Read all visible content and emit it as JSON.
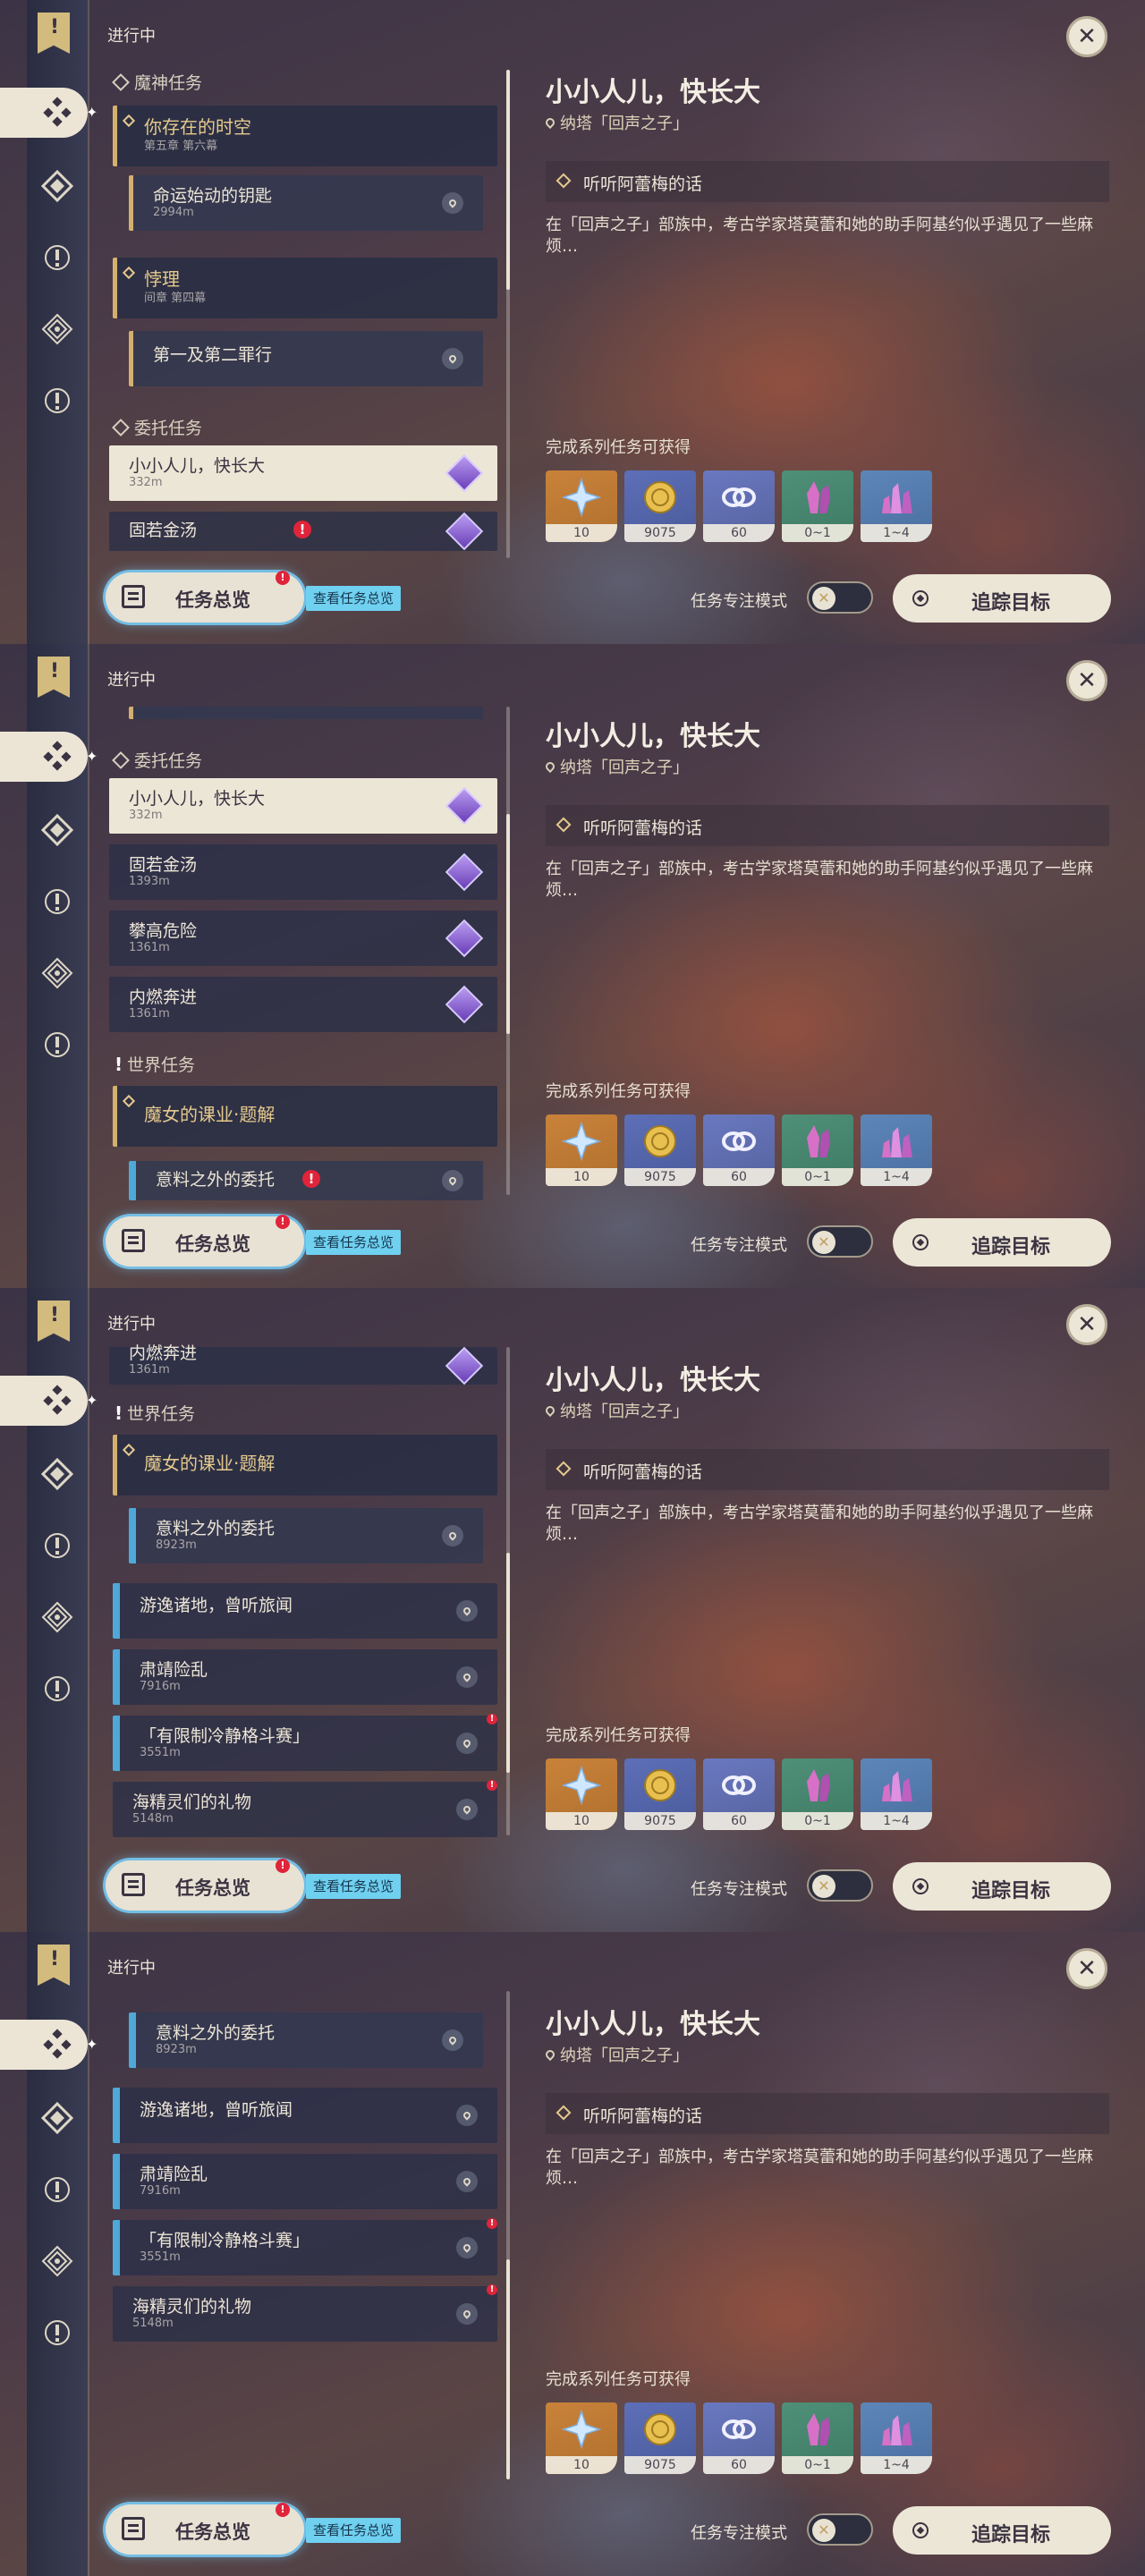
{
  "header": {
    "label": "进行中"
  },
  "sections": {
    "archon": "魔神任务",
    "commission": "委托任务",
    "world": "世界任务"
  },
  "archon_quests": [
    {
      "title": "你存在的时空",
      "chapter": "第五章 第六幕",
      "subquest": {
        "title": "命运始动的钥匙",
        "distance": "2994m"
      }
    },
    {
      "title": "悖理",
      "chapter": "间章 第四幕",
      "subquest": {
        "title": "第一及第二罪行",
        "distance": ""
      }
    }
  ],
  "commissions": [
    {
      "title": "小小人儿，快长大",
      "distance": "332m"
    },
    {
      "title": "固若金汤",
      "distance": "1393m"
    },
    {
      "title": "攀高危险",
      "distance": "1361m"
    },
    {
      "title": "内燃奔进",
      "distance": "1361m"
    }
  ],
  "world_group": {
    "title": "魔女的课业·题解"
  },
  "world_quests": [
    {
      "title": "意料之外的委托",
      "distance": "8923m"
    },
    {
      "title": "游逸诸地，曾听旅闻",
      "distance": ""
    },
    {
      "title": "肃靖险乱",
      "distance": "7916m"
    },
    {
      "title": "「有限制冷静格斗赛」",
      "distance": "3551m"
    },
    {
      "title": "海精灵们的礼物",
      "distance": "5148m"
    }
  ],
  "buttons": {
    "overview": "任务总览",
    "view_overview": "查看任务总览",
    "focus_mode": "任务专注模式",
    "track": "追踪目标",
    "close": "✕"
  },
  "detail": {
    "title": "小小人儿，快长大",
    "location": "纳塔「回声之子」",
    "step": "听听阿蕾梅的话",
    "description": "在「回声之子」部族中，考古学家塔莫蕾和她的助手阿基约似乎遇见了一些麻烦…",
    "reward_header": "完成系列任务可获得",
    "rewards": [
      {
        "icon": "adventure-exp-icon",
        "amount": "10"
      },
      {
        "icon": "mora-icon",
        "amount": "9075"
      },
      {
        "icon": "companionship-exp-icon",
        "amount": "60"
      },
      {
        "icon": "crystal-ore-icon",
        "amount": "0~1"
      },
      {
        "icon": "crystal-chunk-icon",
        "amount": "1~4"
      }
    ]
  },
  "colors": {
    "accent_gold": "#d3b06e",
    "world_blue": "#4ea8d8",
    "alert_red": "#e0243a",
    "cream": "#ece6d6"
  }
}
